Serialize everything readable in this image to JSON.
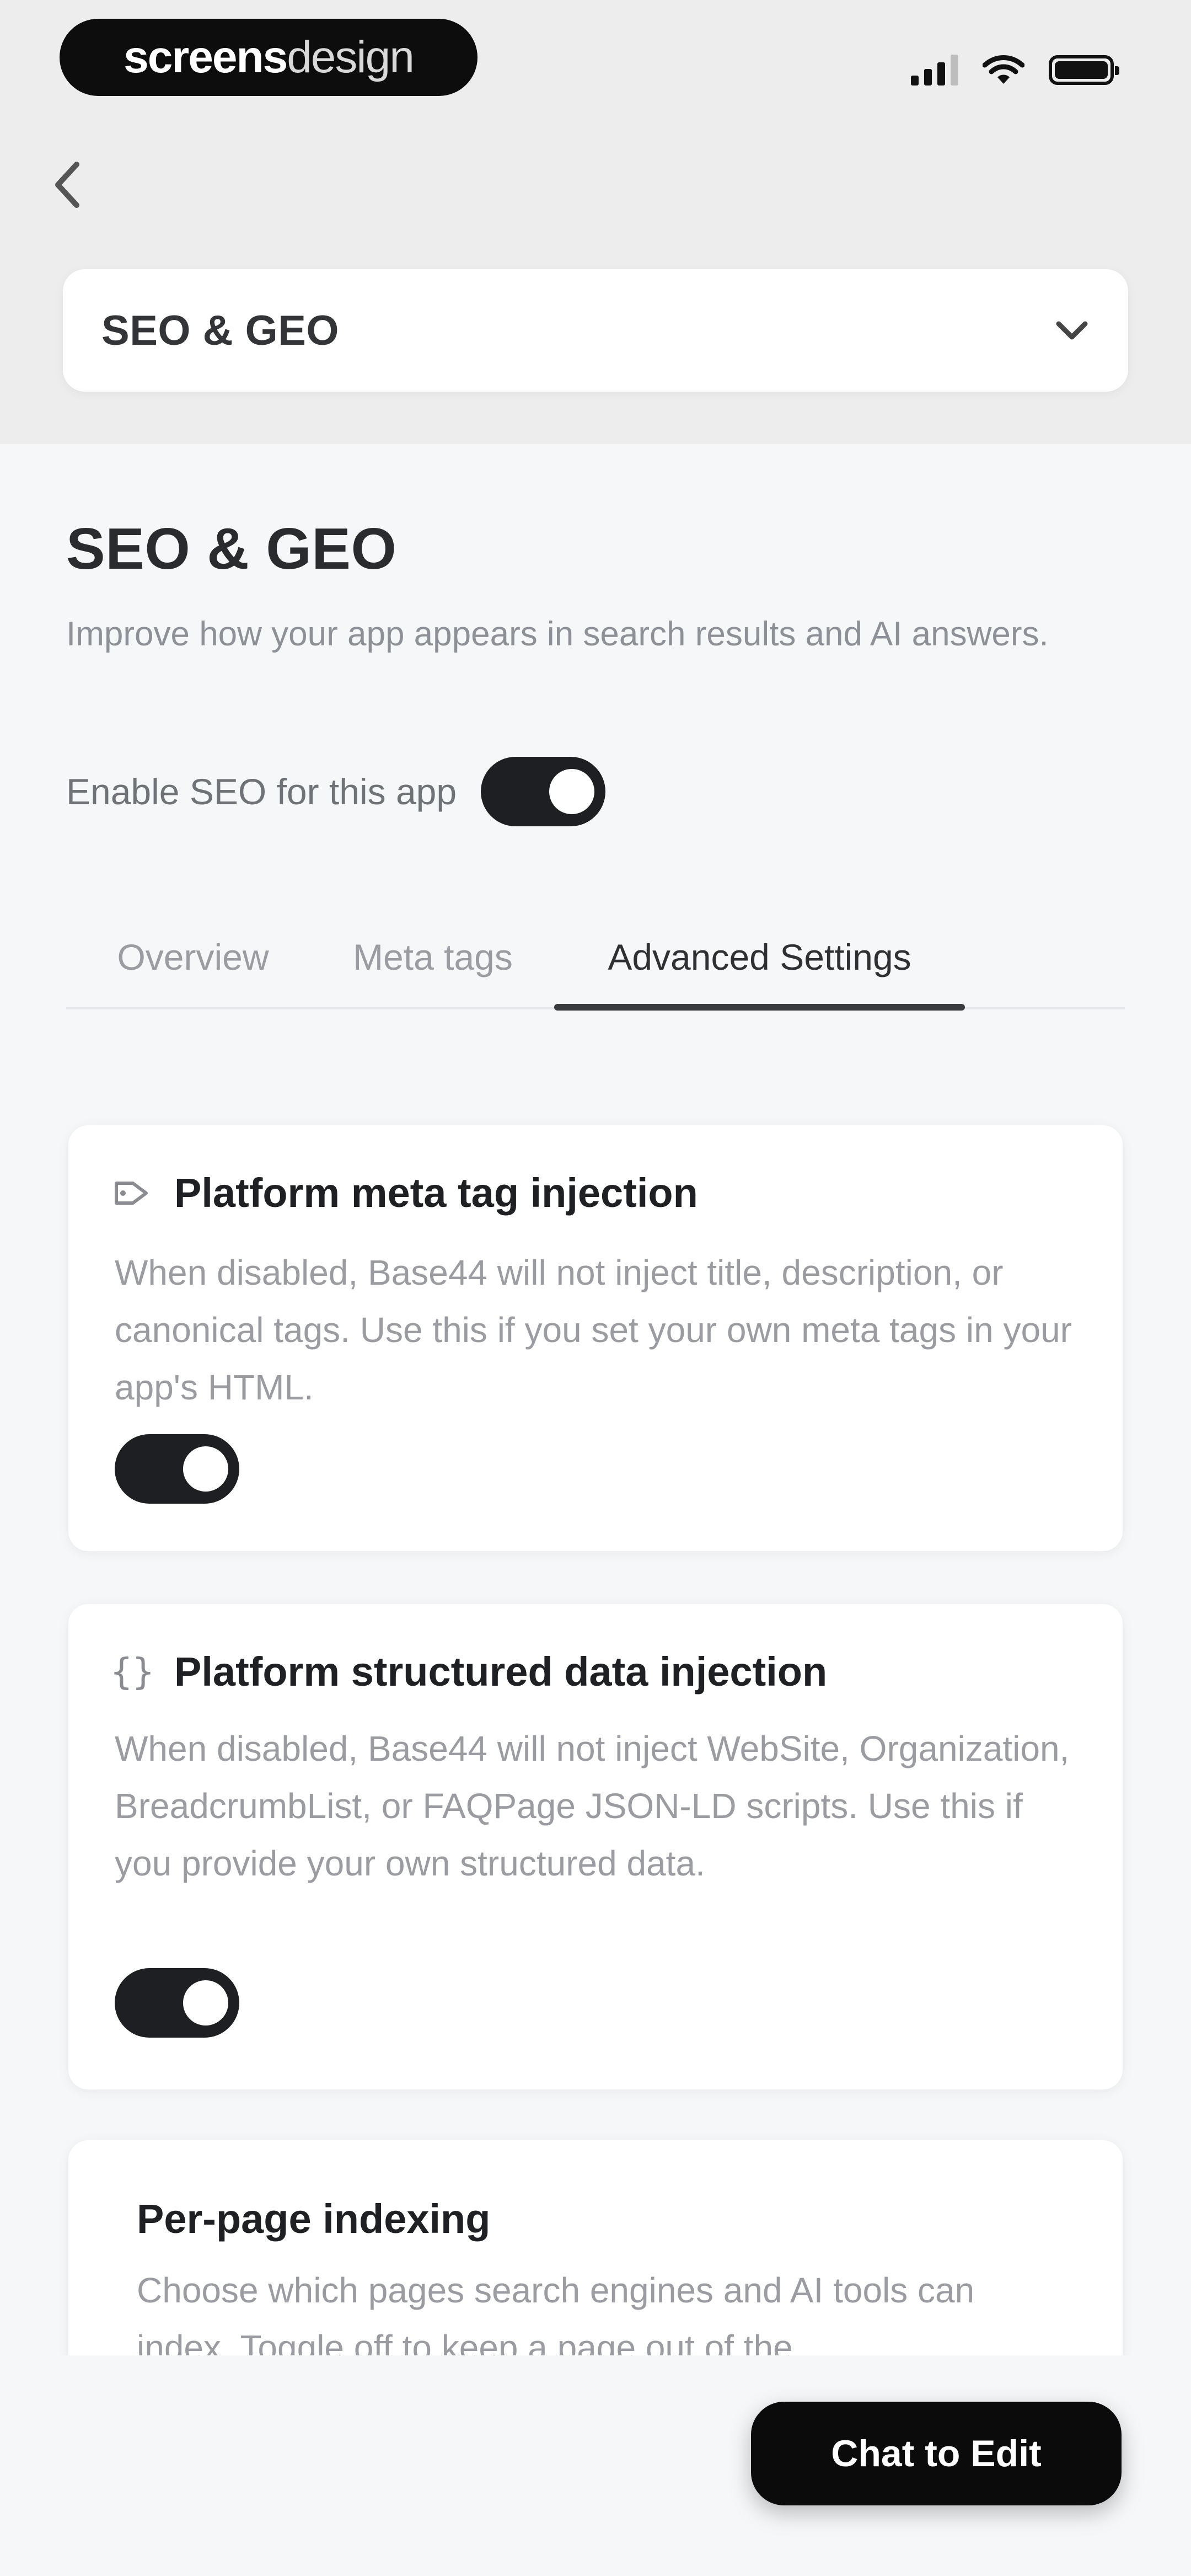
{
  "status_bar": {
    "brand_left": "screens",
    "brand_right": "design"
  },
  "header": {
    "back_icon": "chevron-left-icon",
    "dropdown": {
      "selected": "SEO & GEO",
      "icon": "chevron-down-icon"
    }
  },
  "page": {
    "title": "SEO & GEO",
    "subtitle": "Improve how your app appears in search results and AI answers.",
    "enable_seo": {
      "label": "Enable SEO for this app",
      "on": true
    }
  },
  "tabs": [
    {
      "label": "Overview",
      "active": false
    },
    {
      "label": "Meta tags",
      "active": false
    },
    {
      "label": "Advanced Settings",
      "active": true
    }
  ],
  "cards": [
    {
      "title": "Platform meta tag injection",
      "icon": "tag-icon",
      "description": "When disabled, Base44 will not inject title, description, or canonical tags. Use this if you set your own meta tags in your app's HTML.",
      "on": true
    },
    {
      "title": "Platform structured data injection",
      "icon_glyph": "{}",
      "icon": "braces-icon",
      "description": "When disabled, Base44 will not inject WebSite, Organization, BreadcrumbList, or FAQPage JSON-LD scripts. Use this if you provide your own structured data.",
      "on": true
    },
    {
      "title": "Per-page indexing",
      "description": "Choose which pages search engines and AI tools can index. Toggle off to keep a page out of the"
    }
  ],
  "chat_button": {
    "label": "Chat to Edit"
  },
  "colors": {
    "accent": "#1e1f22",
    "background": "#f6f7f9",
    "header_bg": "#ededed"
  }
}
